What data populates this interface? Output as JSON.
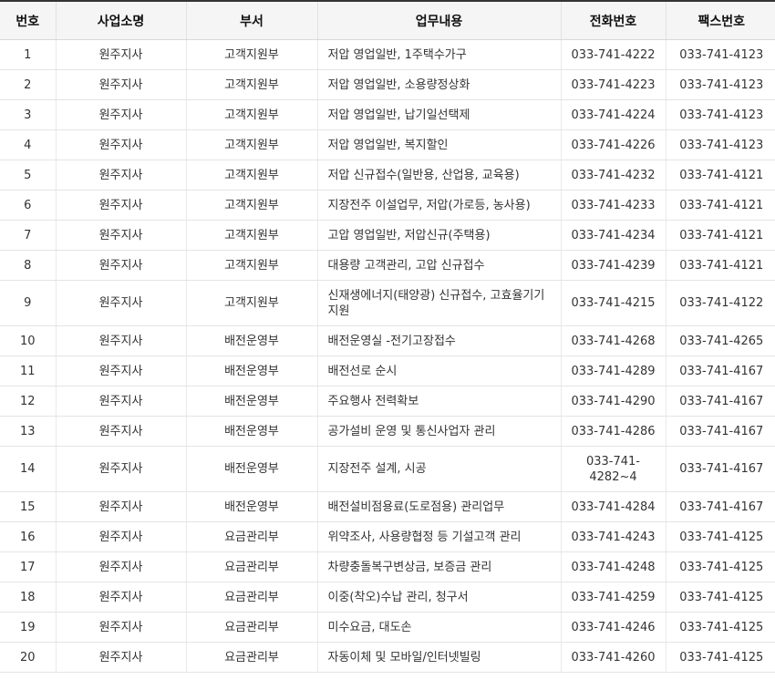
{
  "table": {
    "headers": {
      "no": "번호",
      "office": "사업소명",
      "dept": "부서",
      "work": "업무내용",
      "tel": "전화번호",
      "fax": "팩스번호"
    },
    "rows": [
      {
        "no": "1",
        "office": "원주지사",
        "dept": "고객지원부",
        "work": "저압 영업일반, 1주택수가구",
        "tel": "033-741-4222",
        "fax": "033-741-4123"
      },
      {
        "no": "2",
        "office": "원주지사",
        "dept": "고객지원부",
        "work": "저압 영업일반, 소용량정상화",
        "tel": "033-741-4223",
        "fax": "033-741-4123"
      },
      {
        "no": "3",
        "office": "원주지사",
        "dept": "고객지원부",
        "work": "저압 영업일반, 납기일선택제",
        "tel": "033-741-4224",
        "fax": "033-741-4123"
      },
      {
        "no": "4",
        "office": "원주지사",
        "dept": "고객지원부",
        "work": "저압 영업일반, 복지할인",
        "tel": "033-741-4226",
        "fax": "033-741-4123"
      },
      {
        "no": "5",
        "office": "원주지사",
        "dept": "고객지원부",
        "work": "저압 신규접수(일반용, 산업용, 교육용)",
        "tel": "033-741-4232",
        "fax": "033-741-4121"
      },
      {
        "no": "6",
        "office": "원주지사",
        "dept": "고객지원부",
        "work": "지장전주 이설업무, 저압(가로등, 농사용)",
        "tel": "033-741-4233",
        "fax": "033-741-4121"
      },
      {
        "no": "7",
        "office": "원주지사",
        "dept": "고객지원부",
        "work": "고압 영업일반, 저압신규(주택용)",
        "tel": "033-741-4234",
        "fax": "033-741-4121"
      },
      {
        "no": "8",
        "office": "원주지사",
        "dept": "고객지원부",
        "work": "대용량 고객관리, 고압 신규접수",
        "tel": "033-741-4239",
        "fax": "033-741-4121"
      },
      {
        "no": "9",
        "office": "원주지사",
        "dept": "고객지원부",
        "work": "신재생에너지(태양광) 신규접수, 고효율기기지원",
        "tel": "033-741-4215",
        "fax": "033-741-4122"
      },
      {
        "no": "10",
        "office": "원주지사",
        "dept": "배전운영부",
        "work": "배전운영실 -전기고장접수",
        "tel": "033-741-4268",
        "fax": "033-741-4265"
      },
      {
        "no": "11",
        "office": "원주지사",
        "dept": "배전운영부",
        "work": "배전선로 순시",
        "tel": "033-741-4289",
        "fax": "033-741-4167"
      },
      {
        "no": "12",
        "office": "원주지사",
        "dept": "배전운영부",
        "work": "주요행사 전력확보",
        "tel": "033-741-4290",
        "fax": "033-741-4167"
      },
      {
        "no": "13",
        "office": "원주지사",
        "dept": "배전운영부",
        "work": "공가설비 운영 및 통신사업자 관리",
        "tel": "033-741-4286",
        "fax": "033-741-4167"
      },
      {
        "no": "14",
        "office": "원주지사",
        "dept": "배전운영부",
        "work": "지장전주 설계, 시공",
        "tel": "033-741-4282~4",
        "fax": "033-741-4167"
      },
      {
        "no": "15",
        "office": "원주지사",
        "dept": "배전운영부",
        "work": "배전설비점용료(도로점용) 관리업무",
        "tel": "033-741-4284",
        "fax": "033-741-4167"
      },
      {
        "no": "16",
        "office": "원주지사",
        "dept": "요금관리부",
        "work": "위약조사, 사용량협정 등 기설고객 관리",
        "tel": "033-741-4243",
        "fax": "033-741-4125"
      },
      {
        "no": "17",
        "office": "원주지사",
        "dept": "요금관리부",
        "work": "차량충돌복구변상금, 보증금 관리",
        "tel": "033-741-4248",
        "fax": "033-741-4125"
      },
      {
        "no": "18",
        "office": "원주지사",
        "dept": "요금관리부",
        "work": "이중(착오)수납 관리, 청구서",
        "tel": "033-741-4259",
        "fax": "033-741-4125"
      },
      {
        "no": "19",
        "office": "원주지사",
        "dept": "요금관리부",
        "work": "미수요금, 대도손",
        "tel": "033-741-4246",
        "fax": "033-741-4125"
      },
      {
        "no": "20",
        "office": "원주지사",
        "dept": "요금관리부",
        "work": "자동이체 및 모바일/인터넷빌링",
        "tel": "033-741-4260",
        "fax": "033-741-4125"
      }
    ]
  }
}
